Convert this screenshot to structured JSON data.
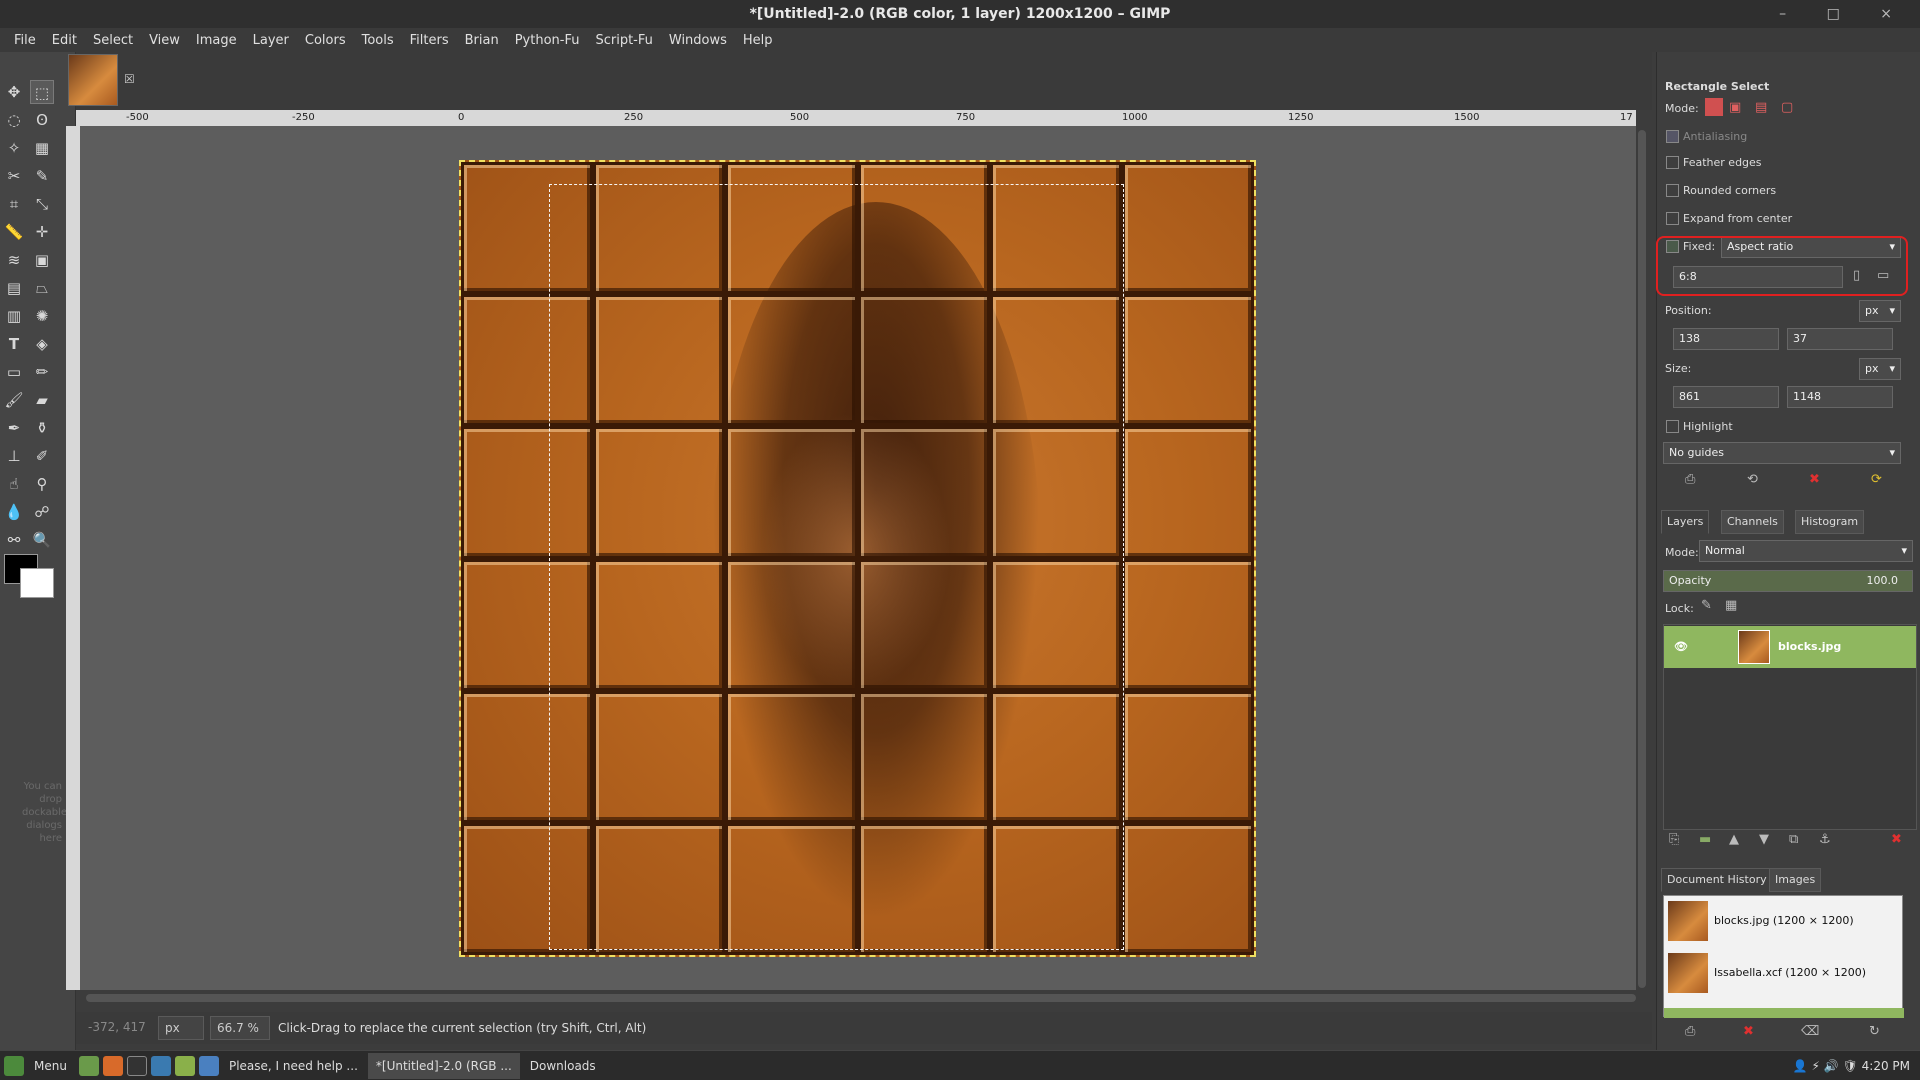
{
  "window": {
    "title": "*[Untitled]-2.0 (RGB color, 1 layer) 1200x1200 – GIMP",
    "controls": [
      "–",
      "□",
      "×"
    ]
  },
  "menu": [
    "File",
    "Edit",
    "Select",
    "View",
    "Image",
    "Layer",
    "Colors",
    "Tools",
    "Filters",
    "Brian",
    "Python-Fu",
    "Script-Fu",
    "Windows",
    "Help"
  ],
  "toolbox": {
    "dock_hint": "You can drop dockable dialogs here",
    "tools": [
      "move-icon",
      "rect-select-icon",
      "ellipse-select-icon",
      "lasso-icon",
      "fuzzy-select-icon",
      "select-by-color-icon",
      "scissors-icon",
      "foreground-select-icon",
      "crop-icon",
      "unified-transform-icon",
      "measure-icon",
      "align-icon",
      "warp-icon",
      "handle-transform-icon",
      "cage-icon",
      "perspective-icon",
      "text-icon",
      "bucket-fill-icon",
      "gradient-icon",
      "pencil-icon",
      "paintbrush-icon",
      "eraser-icon",
      "airbrush-icon",
      "ink-icon",
      "clone-icon",
      "heal-icon",
      "smudge-icon",
      "color-picker-icon",
      "blur-icon",
      "dodge-burn-icon",
      "paths-icon",
      "zoom-icon"
    ]
  },
  "ruler": {
    "ticks": [
      "-500",
      "-250",
      "0",
      "250",
      "500",
      "750",
      "1000",
      "1250",
      "1500",
      "17"
    ]
  },
  "status": {
    "coords": "-372, 417",
    "unit": "px",
    "zoom": "66.7 %",
    "message": "Click-Drag to replace the current selection (try Shift, Ctrl, Alt)"
  },
  "tool_options": {
    "title": "Rectangle Select",
    "mode_label": "Mode:",
    "antialiasing": "Antialiasing",
    "feather": "Feather edges",
    "rounded": "Rounded corners",
    "expand": "Expand from center",
    "fixed_label": "Fixed:",
    "fixed_value": "Aspect ratio",
    "ratio": "6:8",
    "position_label": "Position:",
    "position_unit": "px",
    "pos_x": "138",
    "pos_y": "37",
    "size_label": "Size:",
    "size_unit": "px",
    "size_w": "861",
    "size_h": "1148",
    "highlight": "Highlight",
    "guides": "No guides"
  },
  "layers_dock": {
    "tabs": [
      "Layers",
      "Channels",
      "Histogram"
    ],
    "mode_label": "Mode:",
    "mode_value": "Normal",
    "opacity_label": "Opacity",
    "opacity_value": "100.0",
    "lock_label": "Lock:",
    "layer_name": "blocks.jpg"
  },
  "history_dock": {
    "tabs": [
      "Document History",
      "Images"
    ],
    "items": [
      "blocks.jpg (1200 × 1200)",
      "Issabella.xcf (1200 × 1200)"
    ]
  },
  "taskbar": {
    "menu": "Menu",
    "items": [
      "Please, I need help ...",
      "*[Untitled]-2.0 (RGB ...",
      "Downloads"
    ],
    "clock": "4:20 PM"
  },
  "colors": {
    "layer_selected": "#8fb75f",
    "highlight_box": "#e02020",
    "selection_marching": "#f0e060"
  }
}
